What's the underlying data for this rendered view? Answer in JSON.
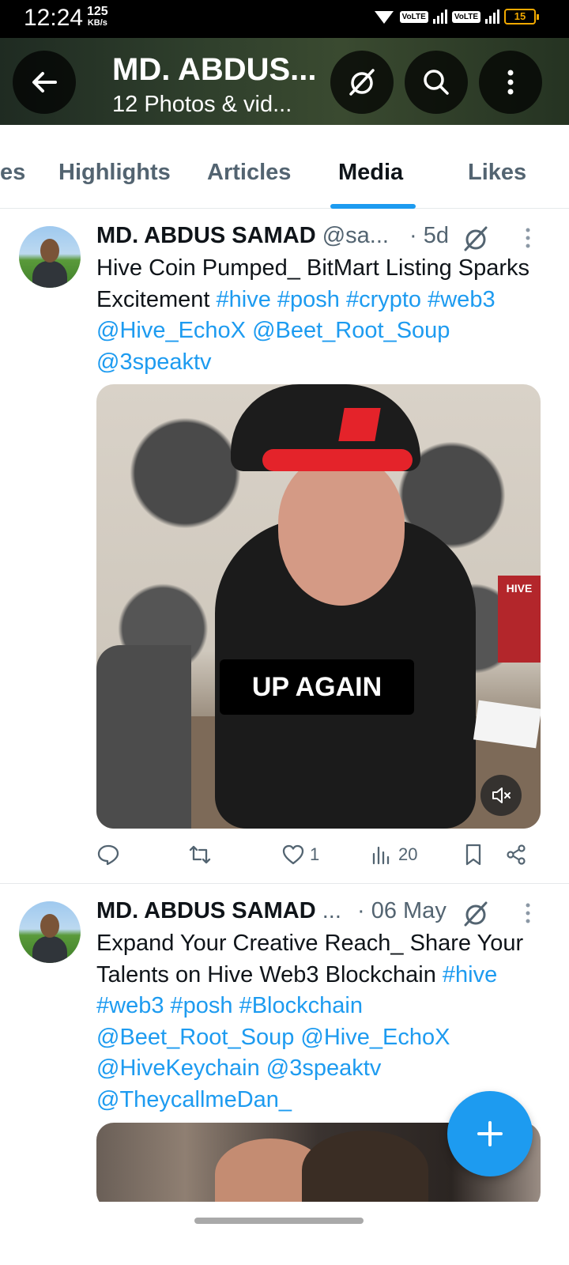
{
  "status_bar": {
    "time": "12:24",
    "net_speed": "125",
    "net_unit": "KB/s",
    "volte_1": "VoLTE",
    "volte_2": "VoLTE",
    "battery": "15"
  },
  "header": {
    "title": "MD. ABDUS...",
    "subtitle": "12 Photos & vid..."
  },
  "tabs": {
    "items": [
      "es",
      "Highlights",
      "Articles",
      "Media",
      "Likes"
    ],
    "active": "Media"
  },
  "posts": [
    {
      "name": "MD. ABDUS SAMAD",
      "handle": "@sa...",
      "time": "· 5d",
      "text_plain": "Hive Coin Pumped_ BitMart Listing Sparks Excitement ",
      "text_links": "#hive #posh #crypto #web3 @Hive_EchoX @Beet_Root_Soup @3speaktv",
      "media_caption": "UP AGAIN",
      "media_sign": "HIVE",
      "likes": "1",
      "views": "20"
    },
    {
      "name": "MD. ABDUS SAMAD",
      "handle": "...",
      "time": "· 06 May",
      "text_plain": "Expand Your Creative Reach_ Share Your Talents on Hive Web3 Blockchain ",
      "text_links": "#hive #web3 #posh #Blockchain @Beet_Root_Soup @Hive_EchoX @HiveKeychain @3speaktv @TheycallmeDan_"
    }
  ],
  "colors": {
    "accent": "#1d9bf0",
    "text": "#0f1419",
    "muted": "#536471"
  },
  "icons": [
    "back-arrow-icon",
    "nostr-icon",
    "search-icon",
    "more-vertical-icon",
    "reply-icon",
    "retweet-icon",
    "like-icon",
    "views-icon",
    "bookmark-icon",
    "share-icon",
    "mute-icon",
    "compose-plus-icon"
  ]
}
